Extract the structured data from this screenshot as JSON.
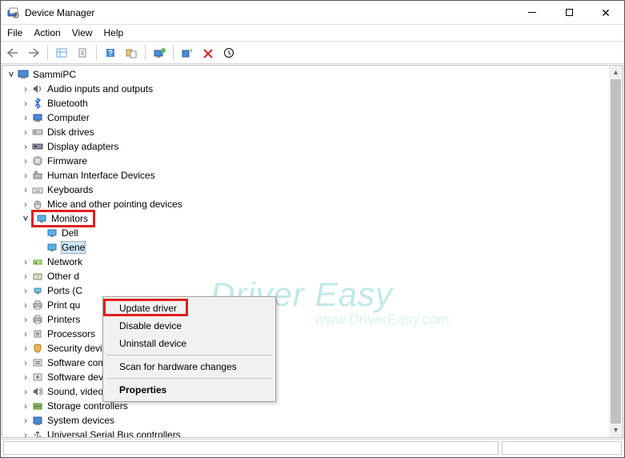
{
  "window": {
    "title": "Device Manager"
  },
  "menu": {
    "file": "File",
    "action": "Action",
    "view": "View",
    "help": "Help"
  },
  "tree": {
    "root": "SammiPC",
    "nodes": {
      "audio": "Audio inputs and outputs",
      "bluetooth": "Bluetooth",
      "computer": "Computer",
      "disk": "Disk drives",
      "display": "Display adapters",
      "firmware": "Firmware",
      "hid": "Human Interface Devices",
      "keyboards": "Keyboards",
      "mice": "Mice and other pointing devices",
      "monitors": "Monitors",
      "monitor_items": {
        "dell": "Dell",
        "generic": "Gene"
      },
      "network": "Network",
      "other": "Other d",
      "ports": "Ports (C",
      "printq": "Print qu",
      "printers": "Printers",
      "processors": "Processors",
      "security": "Security devices",
      "swcomp": "Software components",
      "swdev": "Software devices",
      "sound": "Sound, video and game controllers",
      "storage": "Storage controllers",
      "system": "System devices",
      "usb": "Universal Serial Bus controllers"
    }
  },
  "context": {
    "update": "Update driver",
    "disable": "Disable device",
    "uninstall": "Uninstall device",
    "scan": "Scan for hardware changes",
    "properties": "Properties"
  },
  "watermark": {
    "brand": "Driver Easy",
    "url": "www.DriverEasy.com"
  }
}
